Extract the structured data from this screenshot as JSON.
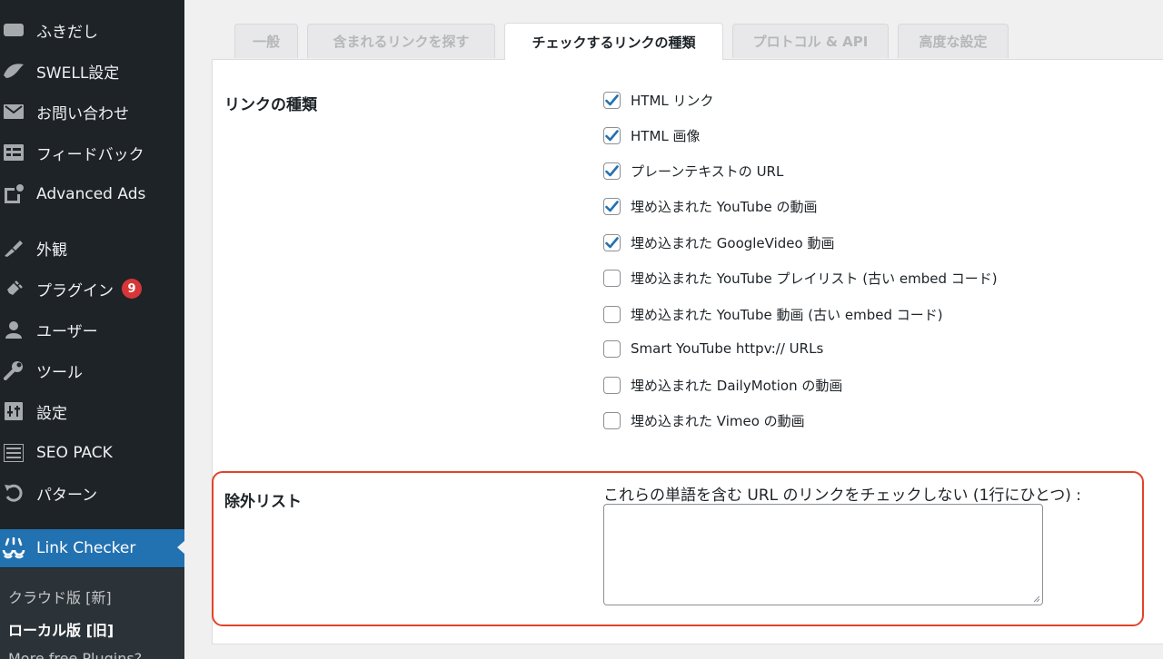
{
  "sidebar": {
    "items": [
      {
        "label": "ふきだし",
        "icon": "speech-bubble-icon"
      },
      {
        "label": "SWELL設定",
        "icon": "swell-wave-icon"
      },
      {
        "label": "お問い合わせ",
        "icon": "mail-icon"
      },
      {
        "label": "フィードバック",
        "icon": "feedback-list-icon"
      },
      {
        "label": "Advanced Ads",
        "icon": "advanced-ads-icon"
      },
      {
        "label": "外観",
        "icon": "paint-brush-icon"
      },
      {
        "label": "プラグイン",
        "icon": "plugin-icon",
        "badge": "9"
      },
      {
        "label": "ユーザー",
        "icon": "user-icon"
      },
      {
        "label": "ツール",
        "icon": "wrench-icon"
      },
      {
        "label": "設定",
        "icon": "settings-sliders-icon"
      },
      {
        "label": "SEO PACK",
        "icon": "seo-list-icon"
      },
      {
        "label": "パターン",
        "icon": "undo-arrow-icon"
      },
      {
        "label": "Link Checker",
        "icon": "link-checker-icon"
      }
    ],
    "submenu": [
      {
        "label": "クラウド版 [新]"
      },
      {
        "label": "ローカル版 [旧]"
      },
      {
        "label": "More free Plugins?"
      }
    ]
  },
  "tabs": [
    {
      "label": "一般"
    },
    {
      "label": "含まれるリンクを探す"
    },
    {
      "label": "チェックするリンクの種類"
    },
    {
      "label": "プロトコル & API"
    },
    {
      "label": "高度な設定"
    }
  ],
  "link_types": {
    "label": "リンクの種類",
    "options": [
      {
        "label": "HTML リンク",
        "checked": true
      },
      {
        "label": "HTML 画像",
        "checked": true
      },
      {
        "label": "プレーンテキストの URL",
        "checked": true
      },
      {
        "label": "埋め込まれた YouTube の動画",
        "checked": true
      },
      {
        "label": "埋め込まれた GoogleVideo 動画",
        "checked": true
      },
      {
        "label": "埋め込まれた YouTube プレイリスト (古い embed コード)",
        "checked": false
      },
      {
        "label": "埋め込まれた YouTube 動画 (古い embed コード)",
        "checked": false
      },
      {
        "label": "Smart YouTube httpv:// URLs",
        "checked": false
      },
      {
        "label": "埋め込まれた DailyMotion の動画",
        "checked": false
      },
      {
        "label": "埋め込まれた Vimeo の動画",
        "checked": false
      }
    ]
  },
  "exclusion": {
    "label": "除外リスト",
    "description": "これらの単語を含む URL のリンクをチェックしない (1行にひとつ) :",
    "value": ""
  },
  "colors": {
    "sidebar_bg": "#1d2327",
    "active_blue": "#2271b1",
    "badge_red": "#d63638",
    "highlight_red": "#e0442a",
    "checkbox_check": "#2271b1"
  }
}
